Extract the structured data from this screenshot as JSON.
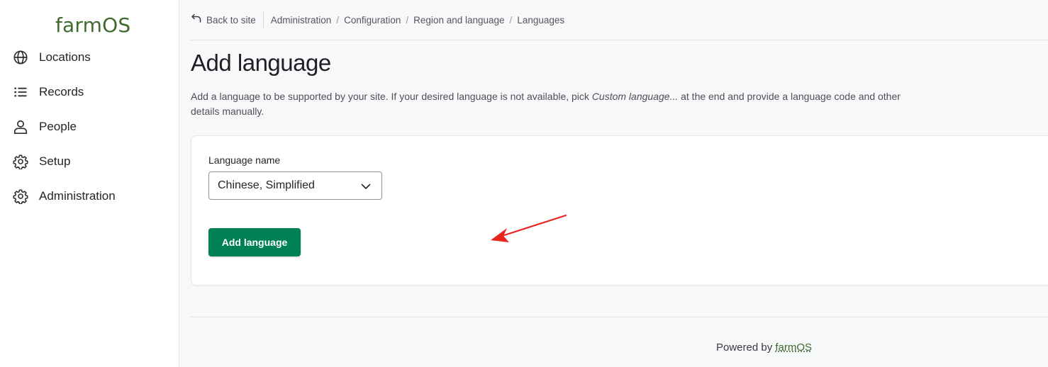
{
  "sidebar": {
    "logo": "farmOS",
    "items": [
      {
        "label": "Locations",
        "icon": "globe-icon"
      },
      {
        "label": "Records",
        "icon": "list-icon"
      },
      {
        "label": "People",
        "icon": "person-icon"
      },
      {
        "label": "Setup",
        "icon": "gear-icon"
      },
      {
        "label": "Administration",
        "icon": "gear-icon"
      }
    ]
  },
  "breadcrumb": {
    "back_label": "Back to site",
    "items": [
      "Administration",
      "Configuration",
      "Region and language",
      "Languages"
    ],
    "separator": "/"
  },
  "page": {
    "title": "Add language",
    "description_before": "Add a language to be supported by your site. If your desired language is not available, pick ",
    "description_em": "Custom language...",
    "description_after": " at the end and provide a language code and other details manually."
  },
  "form": {
    "field_label": "Language name",
    "selected_value": "Chinese, Simplified",
    "submit_label": "Add language"
  },
  "footer": {
    "text": "Powered by ",
    "link": "farmOS"
  },
  "colors": {
    "brand": "#3f6b2e",
    "primary_button": "#008055",
    "annotation": "#e8231e"
  }
}
